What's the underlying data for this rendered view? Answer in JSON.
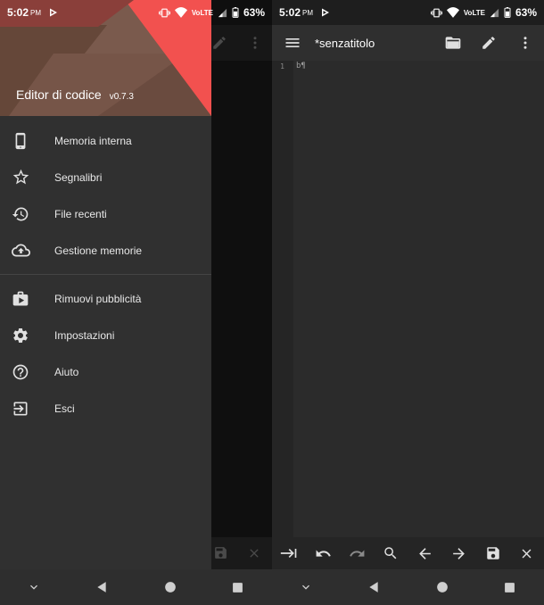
{
  "status_bar": {
    "time": "5:02",
    "ampm": "PM",
    "volte": "VoLTE",
    "battery": "63%"
  },
  "drawer": {
    "app_title": "Editor di codice",
    "version": "v0.7.3",
    "group1": [
      {
        "label": "Memoria interna",
        "icon": "phone-icon"
      },
      {
        "label": "Segnalibri",
        "icon": "star-icon"
      },
      {
        "label": "File recenti",
        "icon": "history-icon"
      },
      {
        "label": "Gestione memorie",
        "icon": "cloud-upload-icon"
      }
    ],
    "group2": [
      {
        "label": "Rimuovi pubblicità",
        "icon": "play-store-icon"
      },
      {
        "label": "Impostazioni",
        "icon": "gear-icon"
      },
      {
        "label": "Aiuto",
        "icon": "help-icon"
      },
      {
        "label": "Esci",
        "icon": "exit-icon"
      }
    ]
  },
  "editor": {
    "document_title": "*senzatitolo",
    "line_numbers": [
      "1"
    ],
    "lines": [
      "b¶"
    ]
  },
  "bottom_toolbar": [
    "tab-icon",
    "undo-icon",
    "redo-icon",
    "search-icon",
    "arrow-left-icon",
    "arrow-right-icon",
    "save-icon",
    "close-icon"
  ],
  "colors": {
    "accent_red": "#f2514f",
    "header_brown": "#6e4e42",
    "drawer_bg": "#303030",
    "editor_bg": "#2b2b2b"
  }
}
